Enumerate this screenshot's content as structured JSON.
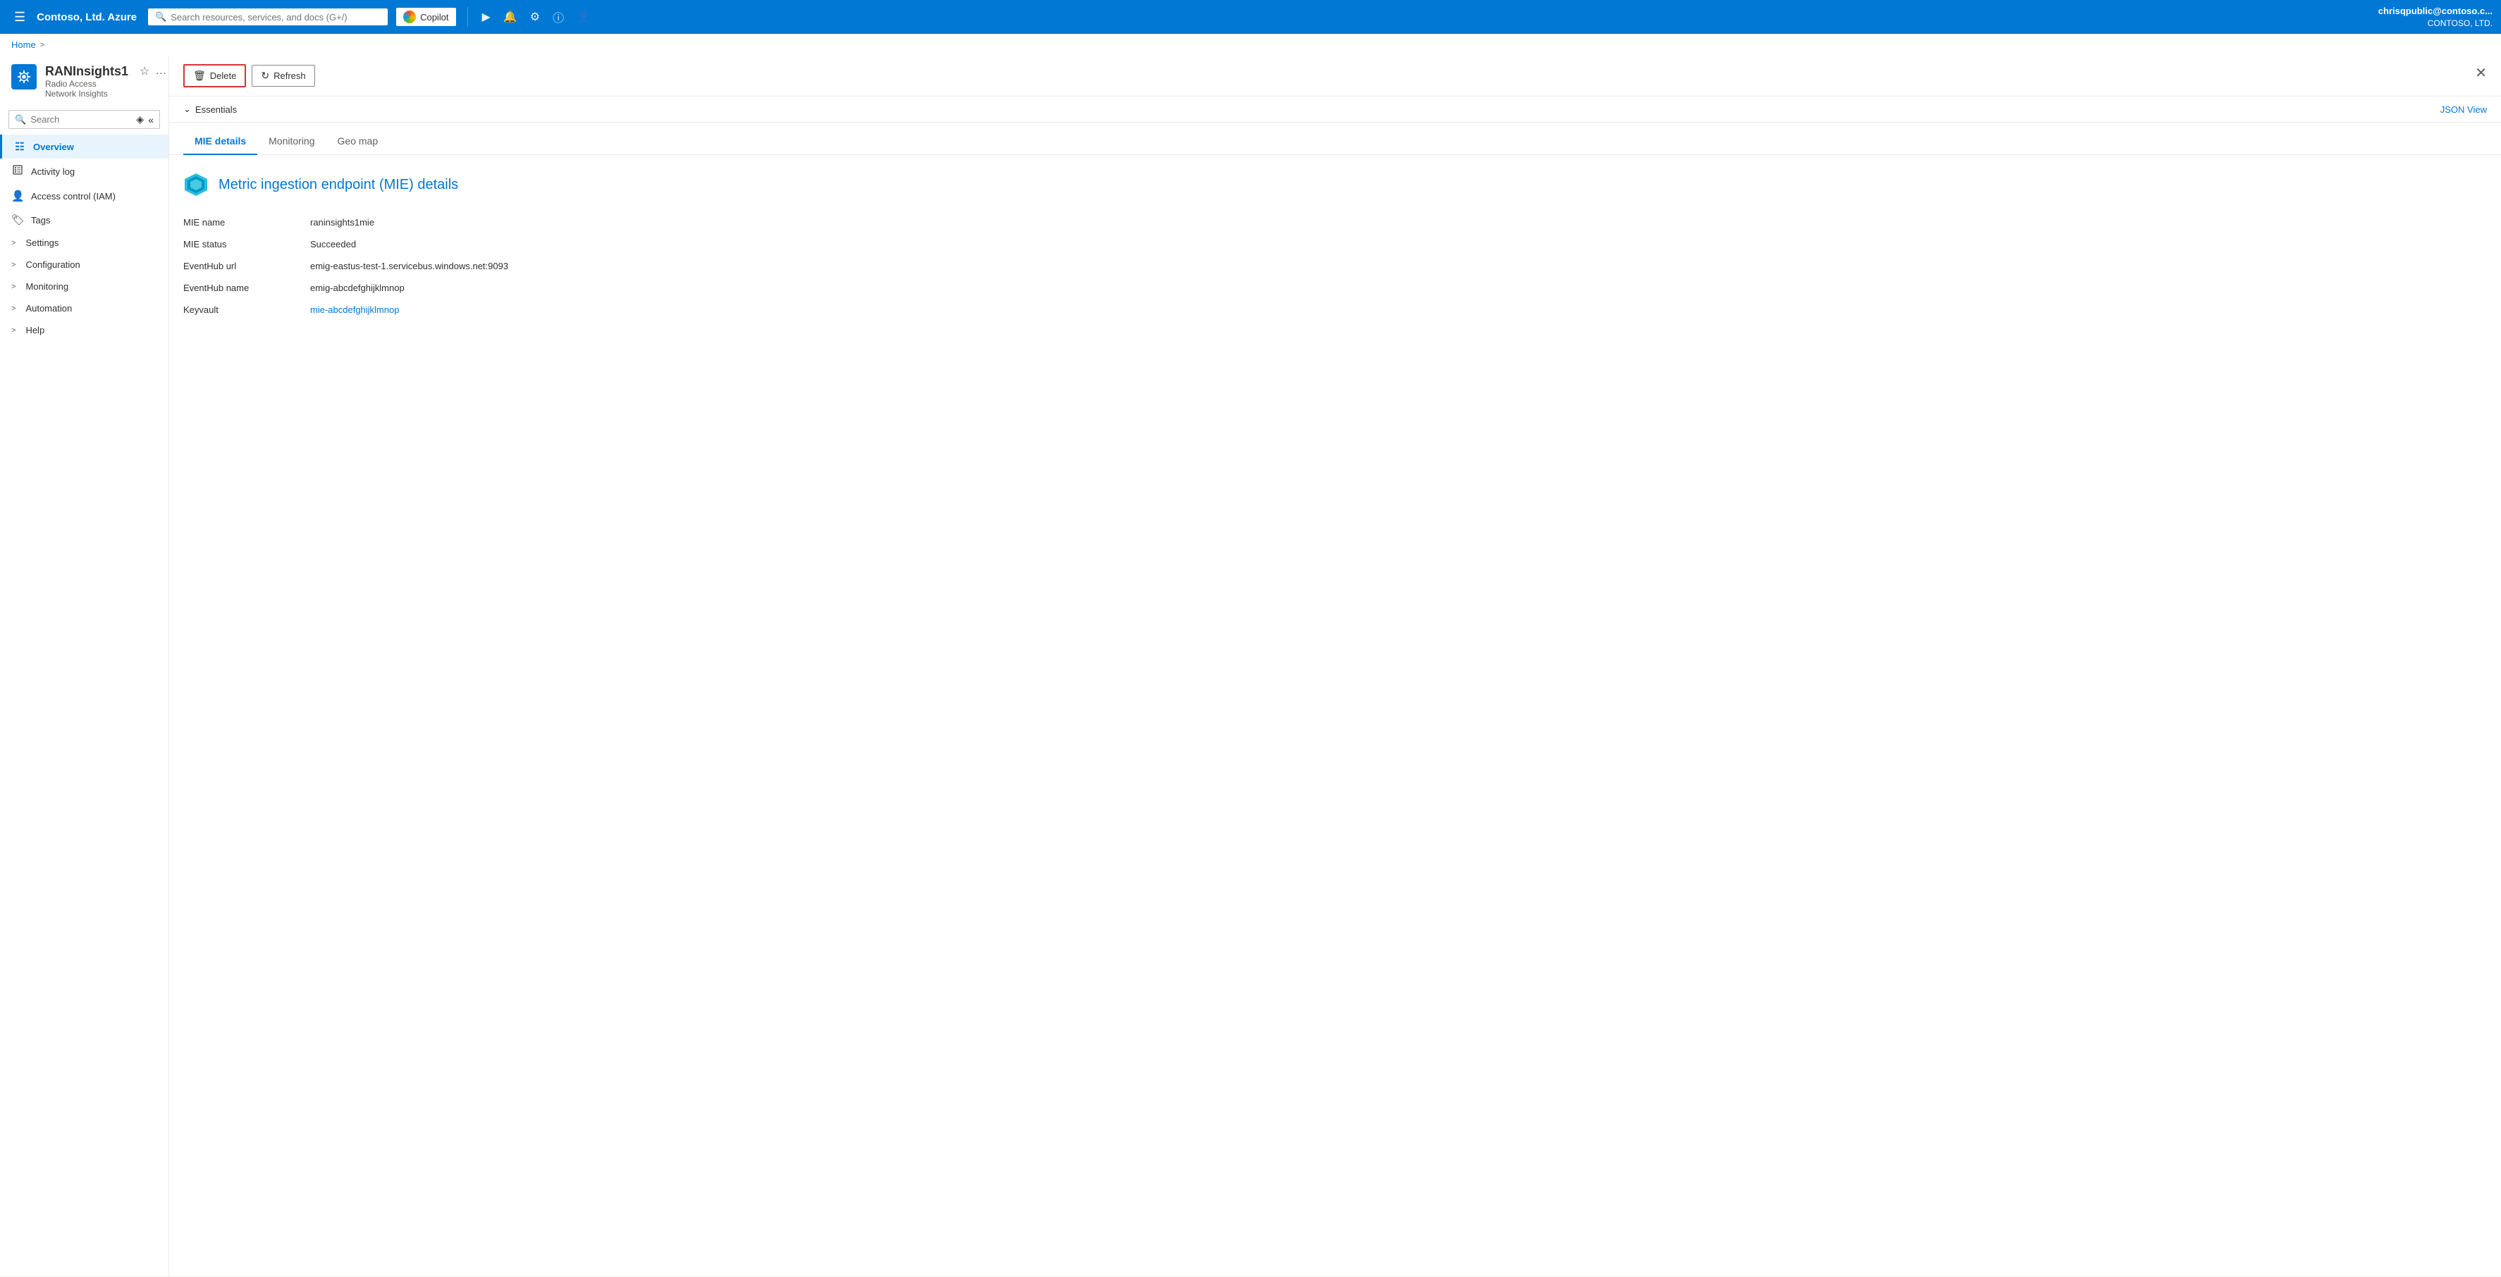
{
  "topnav": {
    "brand": "Contoso, Ltd. Azure",
    "search_placeholder": "Search resources, services, and docs (G+/)",
    "copilot_label": "Copilot",
    "user_name": "chrisqpublic@contoso.c...",
    "user_org": "CONTOSO, LTD."
  },
  "breadcrumb": {
    "home": "Home"
  },
  "resource": {
    "title": "RANInsights1",
    "subtitle": "Radio Access Network Insights"
  },
  "sidebar": {
    "search_placeholder": "Search",
    "nav_items": [
      {
        "id": "overview",
        "label": "Overview",
        "active": true,
        "has_arrow": false,
        "icon": "grid"
      },
      {
        "id": "activity-log",
        "label": "Activity log",
        "active": false,
        "has_arrow": false,
        "icon": "list"
      },
      {
        "id": "access-control",
        "label": "Access control (IAM)",
        "active": false,
        "has_arrow": false,
        "icon": "person"
      },
      {
        "id": "tags",
        "label": "Tags",
        "active": false,
        "has_arrow": false,
        "icon": "tag"
      },
      {
        "id": "settings",
        "label": "Settings",
        "active": false,
        "has_arrow": true,
        "icon": ""
      },
      {
        "id": "configuration",
        "label": "Configuration",
        "active": false,
        "has_arrow": true,
        "icon": ""
      },
      {
        "id": "monitoring",
        "label": "Monitoring",
        "active": false,
        "has_arrow": true,
        "icon": ""
      },
      {
        "id": "automation",
        "label": "Automation",
        "active": false,
        "has_arrow": true,
        "icon": ""
      },
      {
        "id": "help",
        "label": "Help",
        "active": false,
        "has_arrow": true,
        "icon": ""
      }
    ]
  },
  "toolbar": {
    "delete_label": "Delete",
    "refresh_label": "Refresh"
  },
  "essentials": {
    "title": "Essentials",
    "json_view_label": "JSON View"
  },
  "tabs": [
    {
      "id": "mie-details",
      "label": "MIE details",
      "active": true
    },
    {
      "id": "monitoring",
      "label": "Monitoring",
      "active": false
    },
    {
      "id": "geo-map",
      "label": "Geo map",
      "active": false
    }
  ],
  "mie": {
    "title": "Metric ingestion endpoint (MIE) details",
    "fields": [
      {
        "label": "MIE name",
        "value": "raninsights1mie",
        "is_link": false
      },
      {
        "label": "MIE status",
        "value": "Succeeded",
        "is_link": false
      },
      {
        "label": "EventHub url",
        "value": "emig-eastus-test-1.servicebus.windows.net:9093",
        "is_link": false
      },
      {
        "label": "EventHub name",
        "value": "emig-abcdefghijklmnop",
        "is_link": false
      },
      {
        "label": "Keyvault",
        "value": "mie-abcdefghijklmnop",
        "is_link": true
      }
    ]
  }
}
